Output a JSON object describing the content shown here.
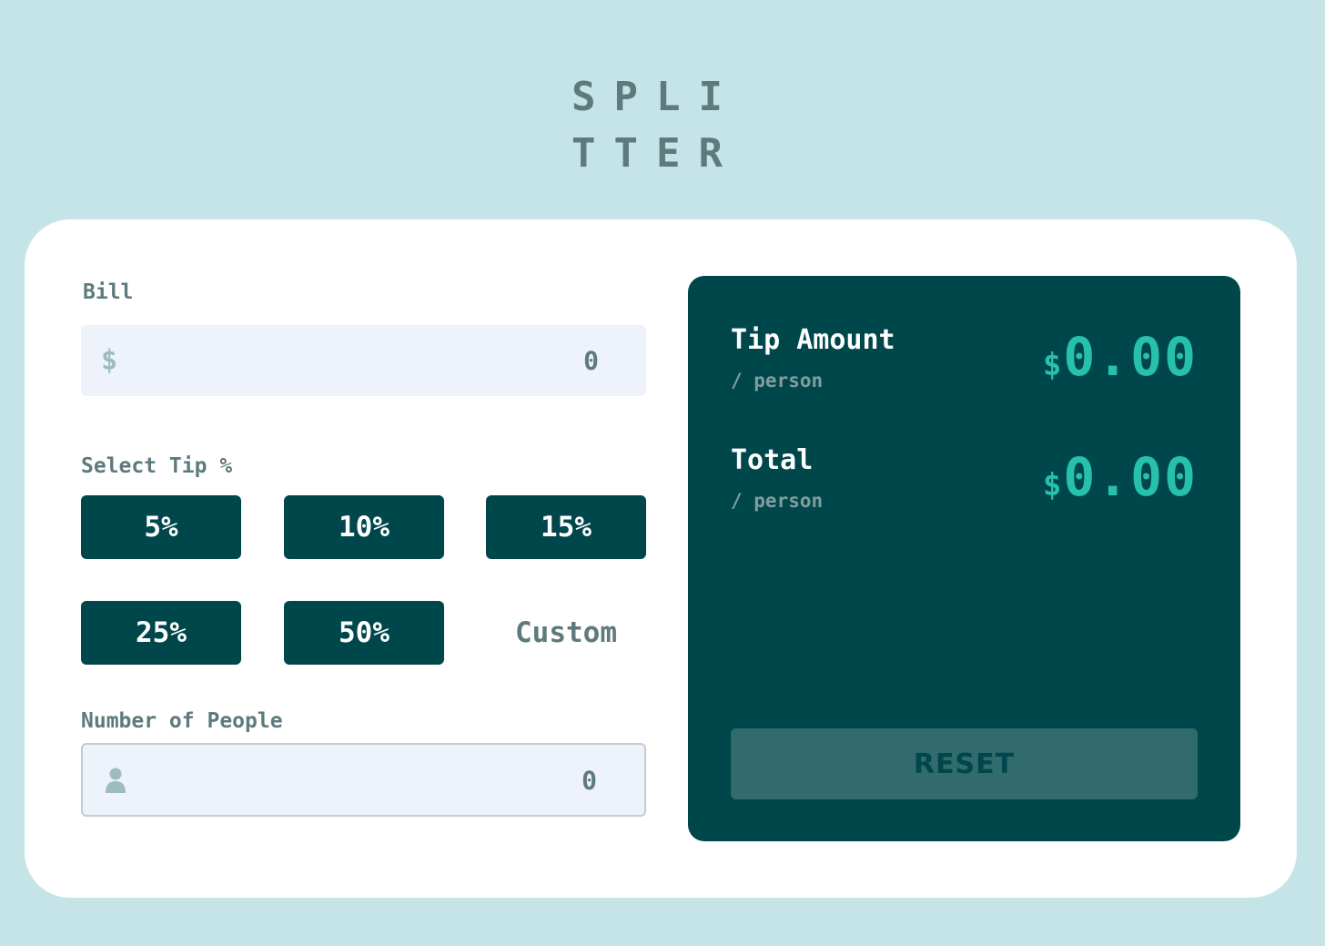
{
  "logo": {
    "line1": "SPLI",
    "line2": "TTER"
  },
  "bill": {
    "label": "Bill",
    "currency_symbol": "$",
    "value": "0"
  },
  "tip": {
    "label": "Select Tip %",
    "options": [
      "5%",
      "10%",
      "15%",
      "25%",
      "50%"
    ],
    "custom_label": "Custom"
  },
  "people": {
    "label": "Number of People",
    "value": "0",
    "icon": "person-icon"
  },
  "results": {
    "tip_amount": {
      "title": "Tip Amount",
      "sub": "/ person",
      "currency": "$",
      "value": "0.00"
    },
    "total": {
      "title": "Total",
      "sub": "/ person",
      "currency": "$",
      "value": "0.00"
    },
    "reset_label": "RESET"
  },
  "colors": {
    "background": "#c5e4e7",
    "card": "#ffffff",
    "dark_cyan": "#00474b",
    "accent": "#26c0ab",
    "input_bg": "#eef2fa",
    "label": "#5e7a7d"
  }
}
